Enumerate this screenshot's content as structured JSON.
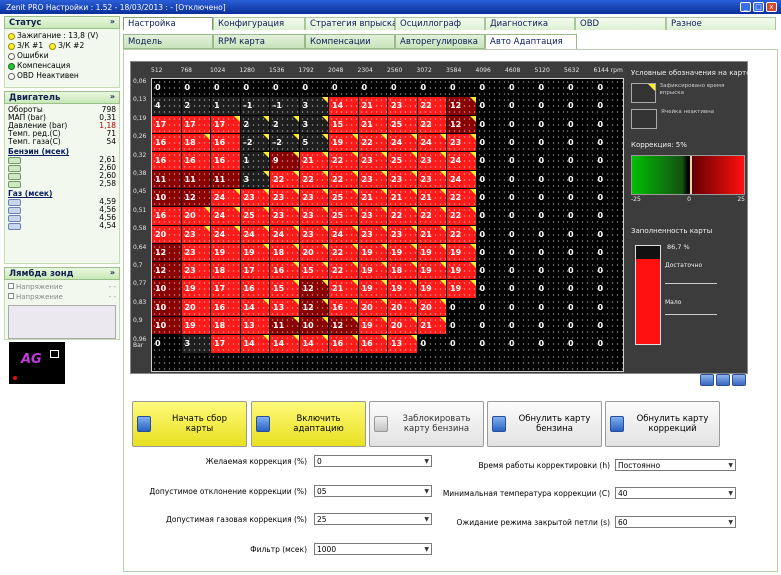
{
  "window": {
    "title": "Zenit PRO Настройки : 1.52 - 18/03/2013 : - [Отключено]",
    "min_label": "_",
    "max_label": "□",
    "close_label": "x"
  },
  "status": {
    "title": "Статус",
    "items": [
      {
        "label": "Зажигание : 13,8 (V)",
        "dot": "yellow"
      },
      {
        "label": "З/К #1",
        "dot": "yellow"
      },
      {
        "label": "З/К #2",
        "dot": "yellow"
      },
      {
        "label": "Ошибки",
        "dot": "white"
      },
      {
        "label": "Компенсация",
        "dot": "green"
      },
      {
        "label": "OBD Неактивен",
        "dot": "white"
      }
    ]
  },
  "engine": {
    "title": "Двигатель",
    "rows": [
      {
        "label": "Обороты",
        "value": "798"
      },
      {
        "label": "МАП (bar)",
        "value": "0,31"
      },
      {
        "label": "Давление (bar)",
        "value": "1,18"
      },
      {
        "label": "Темп. ред.(C)",
        "value": "71"
      },
      {
        "label": "Темп. газа(C)",
        "value": "54"
      }
    ],
    "petrol_label": "Бенэин (мсек)",
    "petrol": [
      "2,61",
      "2,60",
      "2,60",
      "2,58"
    ],
    "gas_label": "Газ (мсек)",
    "gas": [
      "4,59",
      "4,56",
      "4,56",
      "4,54"
    ]
  },
  "lambda": {
    "title": "Лямбда зонд",
    "rows": [
      {
        "label": "Напряжение",
        "value": "- -"
      },
      {
        "label": "Напряжение",
        "value": "- -"
      }
    ]
  },
  "logo": {
    "text": "AG"
  },
  "tabs_top": [
    {
      "label": "Настройка",
      "active": true
    },
    {
      "label": "Конфигурация"
    },
    {
      "label": "Стратегия впрыска"
    },
    {
      "label": "Осциллограф"
    },
    {
      "label": "Диагностика"
    },
    {
      "label": "OBD"
    },
    {
      "label": "Разное"
    }
  ],
  "tabs_sub": [
    {
      "label": "Модель"
    },
    {
      "label": "RPM карта"
    },
    {
      "label": "Компенсации"
    },
    {
      "label": "Авторегулировка"
    },
    {
      "label": "Авто Адаптация",
      "active": true
    }
  ],
  "map": {
    "rpm": [
      "512",
      "768",
      "1024",
      "1280",
      "1536",
      "1792",
      "2048",
      "2304",
      "2560",
      "3072",
      "3584",
      "4096",
      "4608",
      "5120",
      "5632",
      "6144 rpm"
    ],
    "pressure": [
      "0,06",
      "0,13",
      "0,19",
      "0,26",
      "0,32",
      "0,38",
      "0,45",
      "0,51",
      "0,58",
      "0,64",
      "0,7",
      "0,77",
      "0,83",
      "0,9",
      "0,96 Bar"
    ],
    "grid": [
      [
        "0",
        "0",
        "0",
        "0",
        "0",
        "0",
        "0",
        "0",
        "0",
        "0",
        "0",
        "0",
        "0",
        "0",
        "0",
        "0"
      ],
      [
        "4",
        "2",
        "1",
        "-1",
        "-1",
        "3",
        "14",
        "21",
        "23",
        "22",
        "12",
        "0",
        "0",
        "0",
        "0",
        "0"
      ],
      [
        "17",
        "17",
        "17",
        "2",
        "2",
        "3",
        "15",
        "21",
        "25",
        "22",
        "12",
        "0",
        "0",
        "0",
        "0",
        "0"
      ],
      [
        "16",
        "18",
        "16",
        "-2",
        "-2",
        "5",
        "19",
        "22",
        "24",
        "24",
        "23",
        "0",
        "0",
        "0",
        "0",
        "0"
      ],
      [
        "16",
        "16",
        "16",
        "1",
        "9",
        "21",
        "22",
        "23",
        "25",
        "23",
        "24",
        "0",
        "0",
        "0",
        "0",
        "0"
      ],
      [
        "11",
        "11",
        "11",
        "3",
        "22",
        "22",
        "22",
        "23",
        "23",
        "23",
        "24",
        "0",
        "0",
        "0",
        "0",
        "0"
      ],
      [
        "10",
        "12",
        "24",
        "23",
        "23",
        "23",
        "25",
        "21",
        "21",
        "21",
        "22",
        "0",
        "0",
        "0",
        "0",
        "0"
      ],
      [
        "16",
        "20",
        "24",
        "25",
        "23",
        "23",
        "25",
        "23",
        "22",
        "22",
        "22",
        "0",
        "0",
        "0",
        "0",
        "0"
      ],
      [
        "20",
        "23",
        "24",
        "24",
        "24",
        "23",
        "24",
        "23",
        "23",
        "21",
        "22",
        "0",
        "0",
        "0",
        "0",
        "0"
      ],
      [
        "12",
        "23",
        "19",
        "19",
        "18",
        "20",
        "22",
        "19",
        "19",
        "19",
        "19",
        "0",
        "0",
        "0",
        "0",
        "0"
      ],
      [
        "12",
        "23",
        "18",
        "17",
        "16",
        "15",
        "22",
        "19",
        "18",
        "19",
        "19",
        "0",
        "0",
        "0",
        "0",
        "0"
      ],
      [
        "10",
        "19",
        "17",
        "16",
        "15",
        "12",
        "21",
        "19",
        "19",
        "19",
        "19",
        "0",
        "0",
        "0",
        "0",
        "0"
      ],
      [
        "10",
        "20",
        "16",
        "14",
        "13",
        "12",
        "16",
        "20",
        "20",
        "20",
        "0",
        "0",
        "0",
        "0",
        "0",
        "0"
      ],
      [
        "10",
        "19",
        "18",
        "13",
        "11",
        "10",
        "12",
        "19",
        "20",
        "21",
        "0",
        "0",
        "0",
        "0",
        "0",
        "0"
      ],
      [
        "0",
        "3",
        "17",
        "14",
        "14",
        "14",
        "16",
        "16",
        "13",
        "0",
        "0",
        "0",
        "0",
        "0",
        "0",
        "0"
      ],
      [
        "",
        "",
        "",
        "",
        "",
        "",
        "",
        "",
        "",
        "",
        "",
        "",
        "",
        "",
        "",
        ""
      ]
    ],
    "marks": [
      [
        0,
        0,
        0,
        0,
        0,
        0,
        0,
        0,
        0,
        0,
        0,
        0,
        0,
        0,
        0,
        0
      ],
      [
        0,
        0,
        0,
        0,
        0,
        1,
        0,
        0,
        0,
        0,
        1,
        0,
        0,
        0,
        0,
        0
      ],
      [
        0,
        0,
        1,
        1,
        1,
        1,
        0,
        0,
        0,
        0,
        1,
        0,
        0,
        0,
        0,
        0
      ],
      [
        0,
        1,
        0,
        1,
        1,
        1,
        1,
        1,
        1,
        1,
        1,
        0,
        0,
        0,
        0,
        0
      ],
      [
        0,
        0,
        0,
        1,
        1,
        1,
        1,
        1,
        1,
        1,
        1,
        0,
        0,
        0,
        0,
        0
      ],
      [
        0,
        0,
        0,
        1,
        1,
        1,
        1,
        1,
        1,
        1,
        1,
        0,
        0,
        0,
        0,
        0
      ],
      [
        0,
        0,
        1,
        1,
        1,
        1,
        1,
        1,
        1,
        1,
        1,
        0,
        0,
        0,
        0,
        0
      ],
      [
        0,
        1,
        1,
        1,
        1,
        1,
        1,
        1,
        1,
        1,
        1,
        0,
        0,
        0,
        0,
        0
      ],
      [
        0,
        1,
        1,
        1,
        1,
        1,
        1,
        1,
        1,
        1,
        1,
        0,
        0,
        0,
        0,
        0
      ],
      [
        0,
        0,
        0,
        1,
        1,
        1,
        1,
        1,
        1,
        1,
        1,
        0,
        0,
        0,
        0,
        0
      ],
      [
        0,
        0,
        0,
        0,
        1,
        1,
        1,
        1,
        1,
        1,
        1,
        0,
        0,
        0,
        0,
        0
      ],
      [
        0,
        0,
        0,
        0,
        1,
        1,
        1,
        1,
        1,
        1,
        1,
        0,
        0,
        0,
        0,
        0
      ],
      [
        0,
        0,
        0,
        1,
        1,
        1,
        1,
        1,
        1,
        1,
        0,
        0,
        0,
        0,
        0,
        0
      ],
      [
        0,
        0,
        0,
        0,
        1,
        1,
        1,
        1,
        1,
        1,
        0,
        0,
        0,
        0,
        0,
        0
      ],
      [
        0,
        0,
        0,
        1,
        1,
        1,
        1,
        1,
        1,
        0,
        0,
        0,
        0,
        0,
        0,
        0
      ],
      [
        0,
        0,
        0,
        0,
        0,
        0,
        0,
        0,
        0,
        0,
        0,
        0,
        0,
        0,
        0,
        0
      ]
    ],
    "colors": {
      "zero": "#000000",
      "cold": "#1e1e1e",
      "warm": "#8a0000",
      "hot": "#ff1a1a"
    }
  },
  "legend": {
    "title": "Условные обозначения на карте",
    "fixed": "Зафиксировано время впрыска",
    "inactive": "Ячейка неактивна",
    "correction": "Коррекция: 5%",
    "scale_min": "-25",
    "scale_mid": "0",
    "scale_max": "25",
    "fill_title": "Заполненность карты",
    "fill_pct": "86,7 %",
    "fill_value": 0.867,
    "enough": "Достаточно",
    "low": "Мало"
  },
  "actions": [
    {
      "label": "Начать сбор карты",
      "style": "yellow"
    },
    {
      "label": "Включить адаптацию",
      "style": "yellow"
    },
    {
      "label": "Заблокировать карту бензина",
      "style": "gray"
    },
    {
      "label": "Обнулить карту бензина",
      "style": "normal"
    },
    {
      "label": "Обнулить карту коррекций",
      "style": "normal"
    }
  ],
  "fields": [
    {
      "label": "Желаемая коррекция (%)",
      "value": "0"
    },
    {
      "label": "Допустимое отклонение коррекции (%)",
      "value": "05"
    },
    {
      "label": "Допустимая газовая коррекция (%)",
      "value": "25"
    },
    {
      "label": "Фильтр (мсек)",
      "value": "1000"
    },
    {
      "label": "Время работы корректировки (h)",
      "value": "Постоянно"
    },
    {
      "label": "Минимальная температура коррекции (C)",
      "value": "40"
    },
    {
      "label": "Ожидание режима закрытой петли (s)",
      "value": "60"
    }
  ]
}
